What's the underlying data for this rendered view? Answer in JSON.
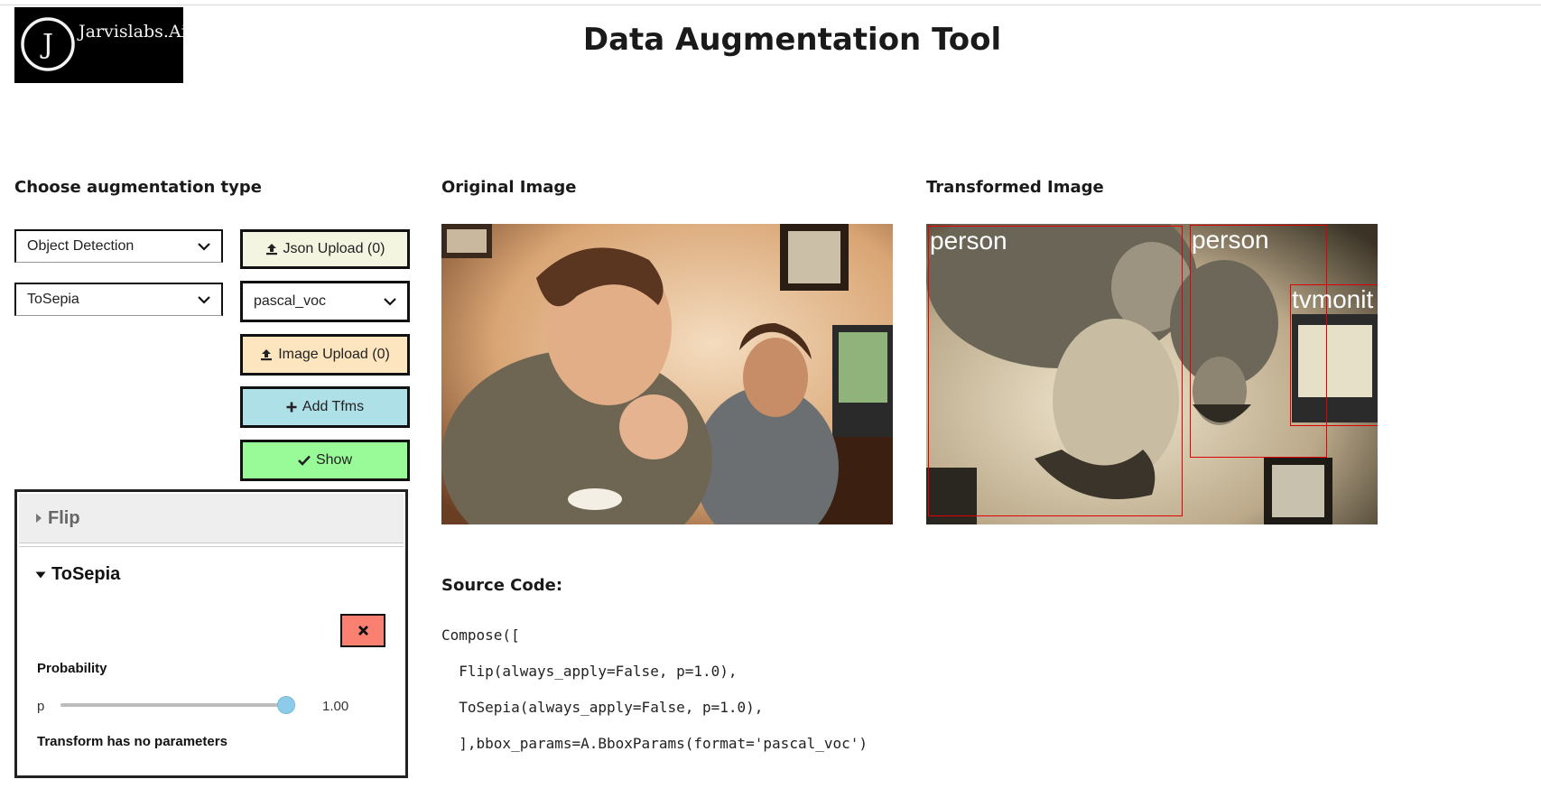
{
  "app": {
    "logo_text": "Jarvislabs.Ai",
    "logo_letter": "J",
    "title": "Data Augmentation Tool"
  },
  "sections": {
    "choose": "Choose augmentation type",
    "original": "Original Image",
    "transformed": "Transformed Image",
    "source": "Source Code:"
  },
  "controls": {
    "task_select": "Object Detection",
    "transform_select": "ToSepia",
    "json_upload": "Json Upload (0)",
    "bbox_format_select": "pascal_voc",
    "image_upload": "Image Upload (0)",
    "add_tfms": "Add Tfms",
    "show": "Show"
  },
  "accordion": {
    "items": [
      {
        "label": "Flip",
        "expanded": false
      },
      {
        "label": "ToSepia",
        "expanded": true
      }
    ],
    "probability_label": "Probability",
    "p_label": "p",
    "p_value": "1.00",
    "p_fraction": 1.0,
    "no_params": "Transform has no parameters"
  },
  "transformed_boxes": [
    {
      "label": "person"
    },
    {
      "label": "person"
    },
    {
      "label": "tvmonit"
    }
  ],
  "code_lines": [
    "Compose([",
    "  Flip(always_apply=False, p=1.0),",
    "  ToSepia(always_apply=False, p=1.0),",
    "  ],bbox_params=A.BboxParams(format='pascal_voc')"
  ],
  "colors": {
    "json_btn": "#f3f5e1",
    "upload_btn": "#fde5bf",
    "tfms_btn": "#aee0e8",
    "show_btn": "#98fb98",
    "delete_btn": "#fa8072",
    "bbox": "#e00000"
  },
  "icons": {
    "upload": "upload-icon",
    "plus": "plus-icon",
    "check": "check-icon",
    "close": "close-icon",
    "caret_right": "caret-right-icon",
    "caret_down": "caret-down-icon",
    "dropdown": "chevron-down-icon"
  }
}
